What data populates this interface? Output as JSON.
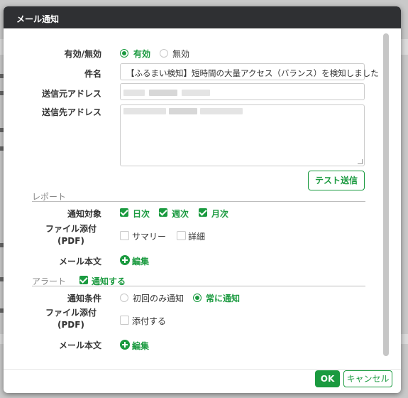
{
  "dialog": {
    "title": "メール通知"
  },
  "status": {
    "label": "有効/無効",
    "options": [
      {
        "label": "有効",
        "selected": true
      },
      {
        "label": "無効",
        "selected": false
      }
    ]
  },
  "subject": {
    "label": "件名",
    "value": "【ふるまい検知】短時間の大量アクセス（バランス）を検知しました"
  },
  "sender": {
    "label": "送信元アドレス"
  },
  "recipient": {
    "label": "送信先アドレス"
  },
  "test_send": {
    "label": "テスト送信"
  },
  "report": {
    "title": "レポート",
    "targets_label": "通知対象",
    "targets": [
      {
        "label": "日次",
        "checked": true
      },
      {
        "label": "週次",
        "checked": true
      },
      {
        "label": "月次",
        "checked": true
      }
    ],
    "attach_label_line1": "ファイル添付",
    "attach_label_line2": "(PDF)",
    "attachments": [
      {
        "label": "サマリー",
        "checked": false
      },
      {
        "label": "詳細",
        "checked": false
      }
    ],
    "body_label": "メール本文",
    "edit_label": "編集"
  },
  "alert": {
    "title": "アラート",
    "notify_label": "通知する",
    "notify_checked": true,
    "condition_label": "通知条件",
    "conditions": [
      {
        "label": "初回のみ通知",
        "selected": false
      },
      {
        "label": "常に通知",
        "selected": true
      }
    ],
    "attach_label_line1": "ファイル添付",
    "attach_label_line2": "(PDF)",
    "attach_option": "添付する",
    "body_label": "メール本文",
    "edit_label": "編集"
  },
  "footer": {
    "ok_label": "OK",
    "cancel_label": "キャンセル"
  },
  "colors": {
    "accent": "#1a9a3f",
    "header_bg": "#2f3033"
  }
}
